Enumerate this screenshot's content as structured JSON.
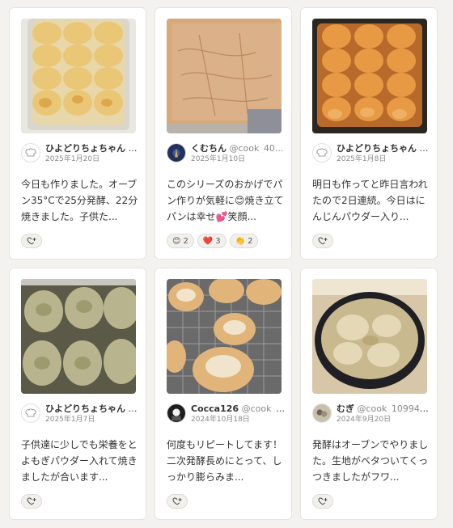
{
  "posts": [
    {
      "user": "ひよどりちょちゃん",
      "user_id": "@...",
      "date": "2025年1月20日",
      "text": "今日も作りました。オーブン35°Cで25分発酵、22分焼きました。子供た...",
      "reactions": [],
      "avatar_icon": "chef-hat-icon"
    },
    {
      "user": "くむちん",
      "user_id": "@cook_40...",
      "date": "2025年1月10日",
      "text": "このシリーズのおかげでパン作りが気軽に😊焼き立てパンは幸せ💕笑顔...",
      "reactions": [
        {
          "emoji": "😊",
          "count": "2"
        },
        {
          "emoji": "❤️",
          "count": "3"
        },
        {
          "emoji": "👏",
          "count": "2"
        }
      ],
      "avatar_icon": "user-photo-icon"
    },
    {
      "user": "ひよどりちょちゃん",
      "user_id": "@...",
      "date": "2025年1月8日",
      "text": "明日も作ってと昨日言われたので2日連続。今日はにんじんパウダー入り...",
      "reactions": [],
      "avatar_icon": "chef-hat-icon"
    },
    {
      "user": "ひよどりちょちゃん",
      "user_id": "@...",
      "date": "2025年1月7日",
      "text": "子供達に少しでも栄養をとよもぎパウダー入れて焼きましたが合います...",
      "reactions": [],
      "avatar_icon": "chef-hat-icon"
    },
    {
      "user": "Cocca126",
      "user_id": "@cook_4...",
      "date": "2024年10月18日",
      "text": "何度もリピートしてます！二次発酵長めにとって、しっかり膨らみま...",
      "reactions": [],
      "avatar_icon": "user-photo-icon"
    },
    {
      "user": "むぎ",
      "user_id": "@cook_109940...",
      "date": "2024年9月20日",
      "text": "発酵はオーブンでやりました。生地がベタついてくっつきましたがフワ...",
      "reactions": [],
      "avatar_icon": "user-photo-icon"
    }
  ],
  "colors": {
    "card_bg": "#ffffff",
    "page_bg": "#f3f2ef",
    "user_text": "#333333",
    "muted_text": "#888888"
  }
}
